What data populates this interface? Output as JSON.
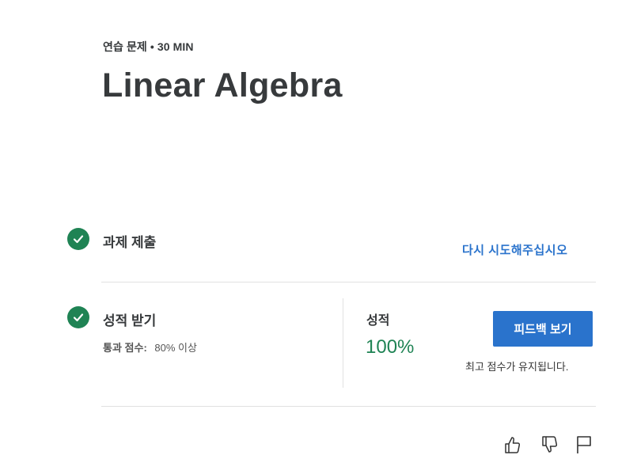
{
  "header": {
    "eyebrow": "연습 문제 • 30 MIN",
    "title": "Linear Algebra"
  },
  "steps": {
    "submit": {
      "title": "과제 제출",
      "action_label": "다시 시도해주십시오"
    },
    "grade": {
      "title": "성적 받기",
      "pass_label": "통과 점수:",
      "pass_value": "80% 이상",
      "grade_label": "성적",
      "grade_value": "100%",
      "feedback_button": "피드백 보기",
      "keep_note": "최고 점수가 유지됩니다."
    }
  },
  "footer_actions": {
    "like_icon": "thumbs-up-icon",
    "dislike_icon": "thumbs-down-icon",
    "report_icon": "flag-icon"
  },
  "colors": {
    "success": "#1f8354",
    "primary": "#2a73cc",
    "text": "#373a3c",
    "divider": "#e1e1e1"
  }
}
